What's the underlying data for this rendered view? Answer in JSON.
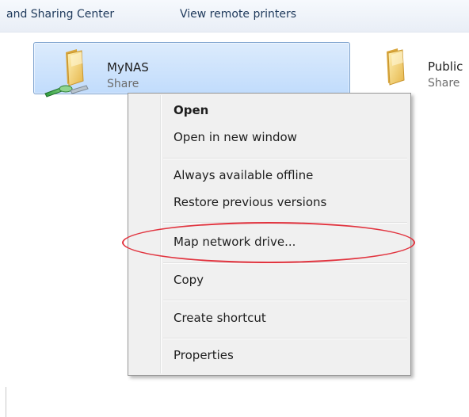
{
  "toolbar": {
    "items": [
      {
        "label": "and Sharing Center"
      },
      {
        "label": "View remote printers"
      }
    ]
  },
  "shares": [
    {
      "name": "MyNAS",
      "type": "Share",
      "selected": true,
      "icon": "network-share-folder-icon"
    },
    {
      "name": "Public",
      "type": "Share",
      "selected": false,
      "icon": "network-share-folder-icon"
    }
  ],
  "context_menu": {
    "items": [
      {
        "label": "Open",
        "bold": true
      },
      {
        "label": "Open in new window"
      },
      {
        "label": "Always available offline"
      },
      {
        "label": "Restore previous versions"
      },
      {
        "label": "Map network drive...",
        "highlighted": true
      },
      {
        "label": "Copy"
      },
      {
        "label": "Create shortcut"
      },
      {
        "label": "Properties"
      }
    ]
  },
  "colors": {
    "selection_fill": "#c1dcfc",
    "selection_border": "#7da2ce",
    "highlight_ring": "#e1343f",
    "menu_background": "#f0f0f0",
    "link_text": "#1e395b"
  }
}
